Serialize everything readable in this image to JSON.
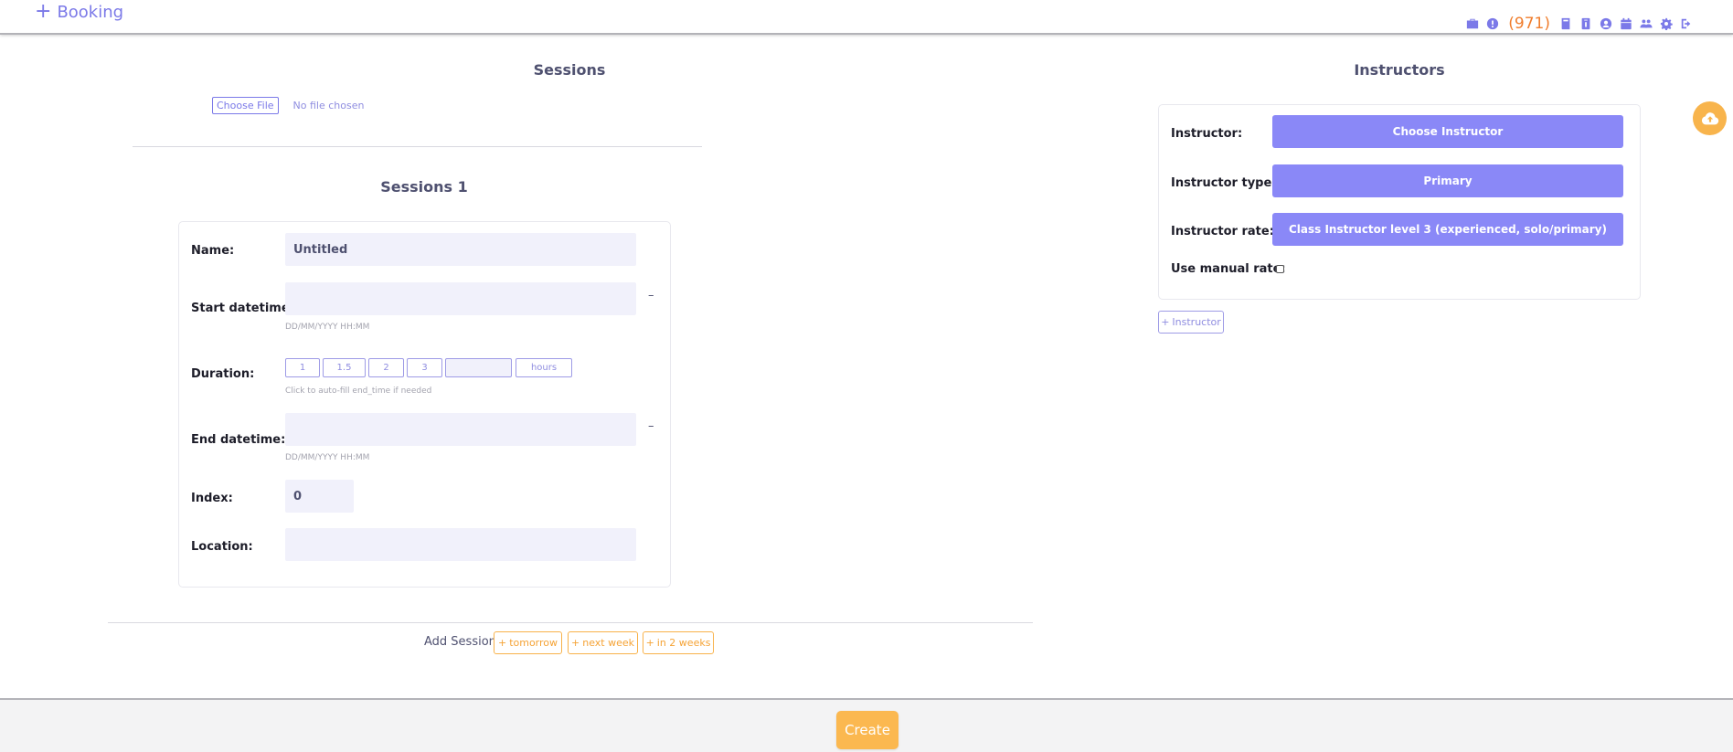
{
  "header": {
    "brand_plus": "+",
    "brand_label": "Booking",
    "count": "(971)",
    "icons": [
      "briefcase-icon",
      "info-icon",
      "book-icon",
      "id-card-icon",
      "user-circle-icon",
      "calendar-icon",
      "users-icon",
      "gear-icon",
      "sign-out-icon"
    ],
    "accent_color": "#7b79e8",
    "count_color": "#f07d2c"
  },
  "sessions": {
    "title": "Sessions",
    "file": {
      "button_label": "Choose File",
      "status": "No file chosen"
    },
    "session_title": "Sessions 1",
    "fields": {
      "name_label": "Name:",
      "name_value": "Untitled",
      "start_label": "Start datetime:",
      "start_value": "",
      "start_hint": "DD/MM/YYYY HH:MM",
      "start_clear": "–",
      "duration_label": "Duration:",
      "duration_options": [
        "1",
        "1.5",
        "2",
        "3"
      ],
      "duration_custom": "",
      "duration_unit": "hours",
      "duration_hint": "Click to auto-fill end_time if needed",
      "end_label": "End datetime:",
      "end_value": "",
      "end_hint": "DD/MM/YYYY HH:MM",
      "end_clear": "–",
      "index_label": "Index:",
      "index_value": "0",
      "location_label": "Location:",
      "location_value": ""
    },
    "add_session": {
      "label": "Add Session",
      "tomorrow": "tomorrow",
      "next_week": "next week",
      "in_2_weeks": "in 2 weeks",
      "plus": "+"
    }
  },
  "instructors": {
    "title": "Instructors",
    "instructor_label": "Instructor:",
    "instructor_value": "Choose Instructor",
    "type_label": "Instructor type:",
    "type_value": "Primary",
    "rate_label": "Instructor rate:",
    "rate_value": "Class Instructor level 3 (experienced, solo/primary)",
    "manual_rate_label": "Use manual rate:",
    "manual_rate_checked": false,
    "add_label": "Instructor",
    "add_plus": "+"
  },
  "footer": {
    "create_label": "Create"
  },
  "colors": {
    "purple": "#8a88f7",
    "orange": "#fbb850",
    "input_bg": "#f1f1fb"
  }
}
